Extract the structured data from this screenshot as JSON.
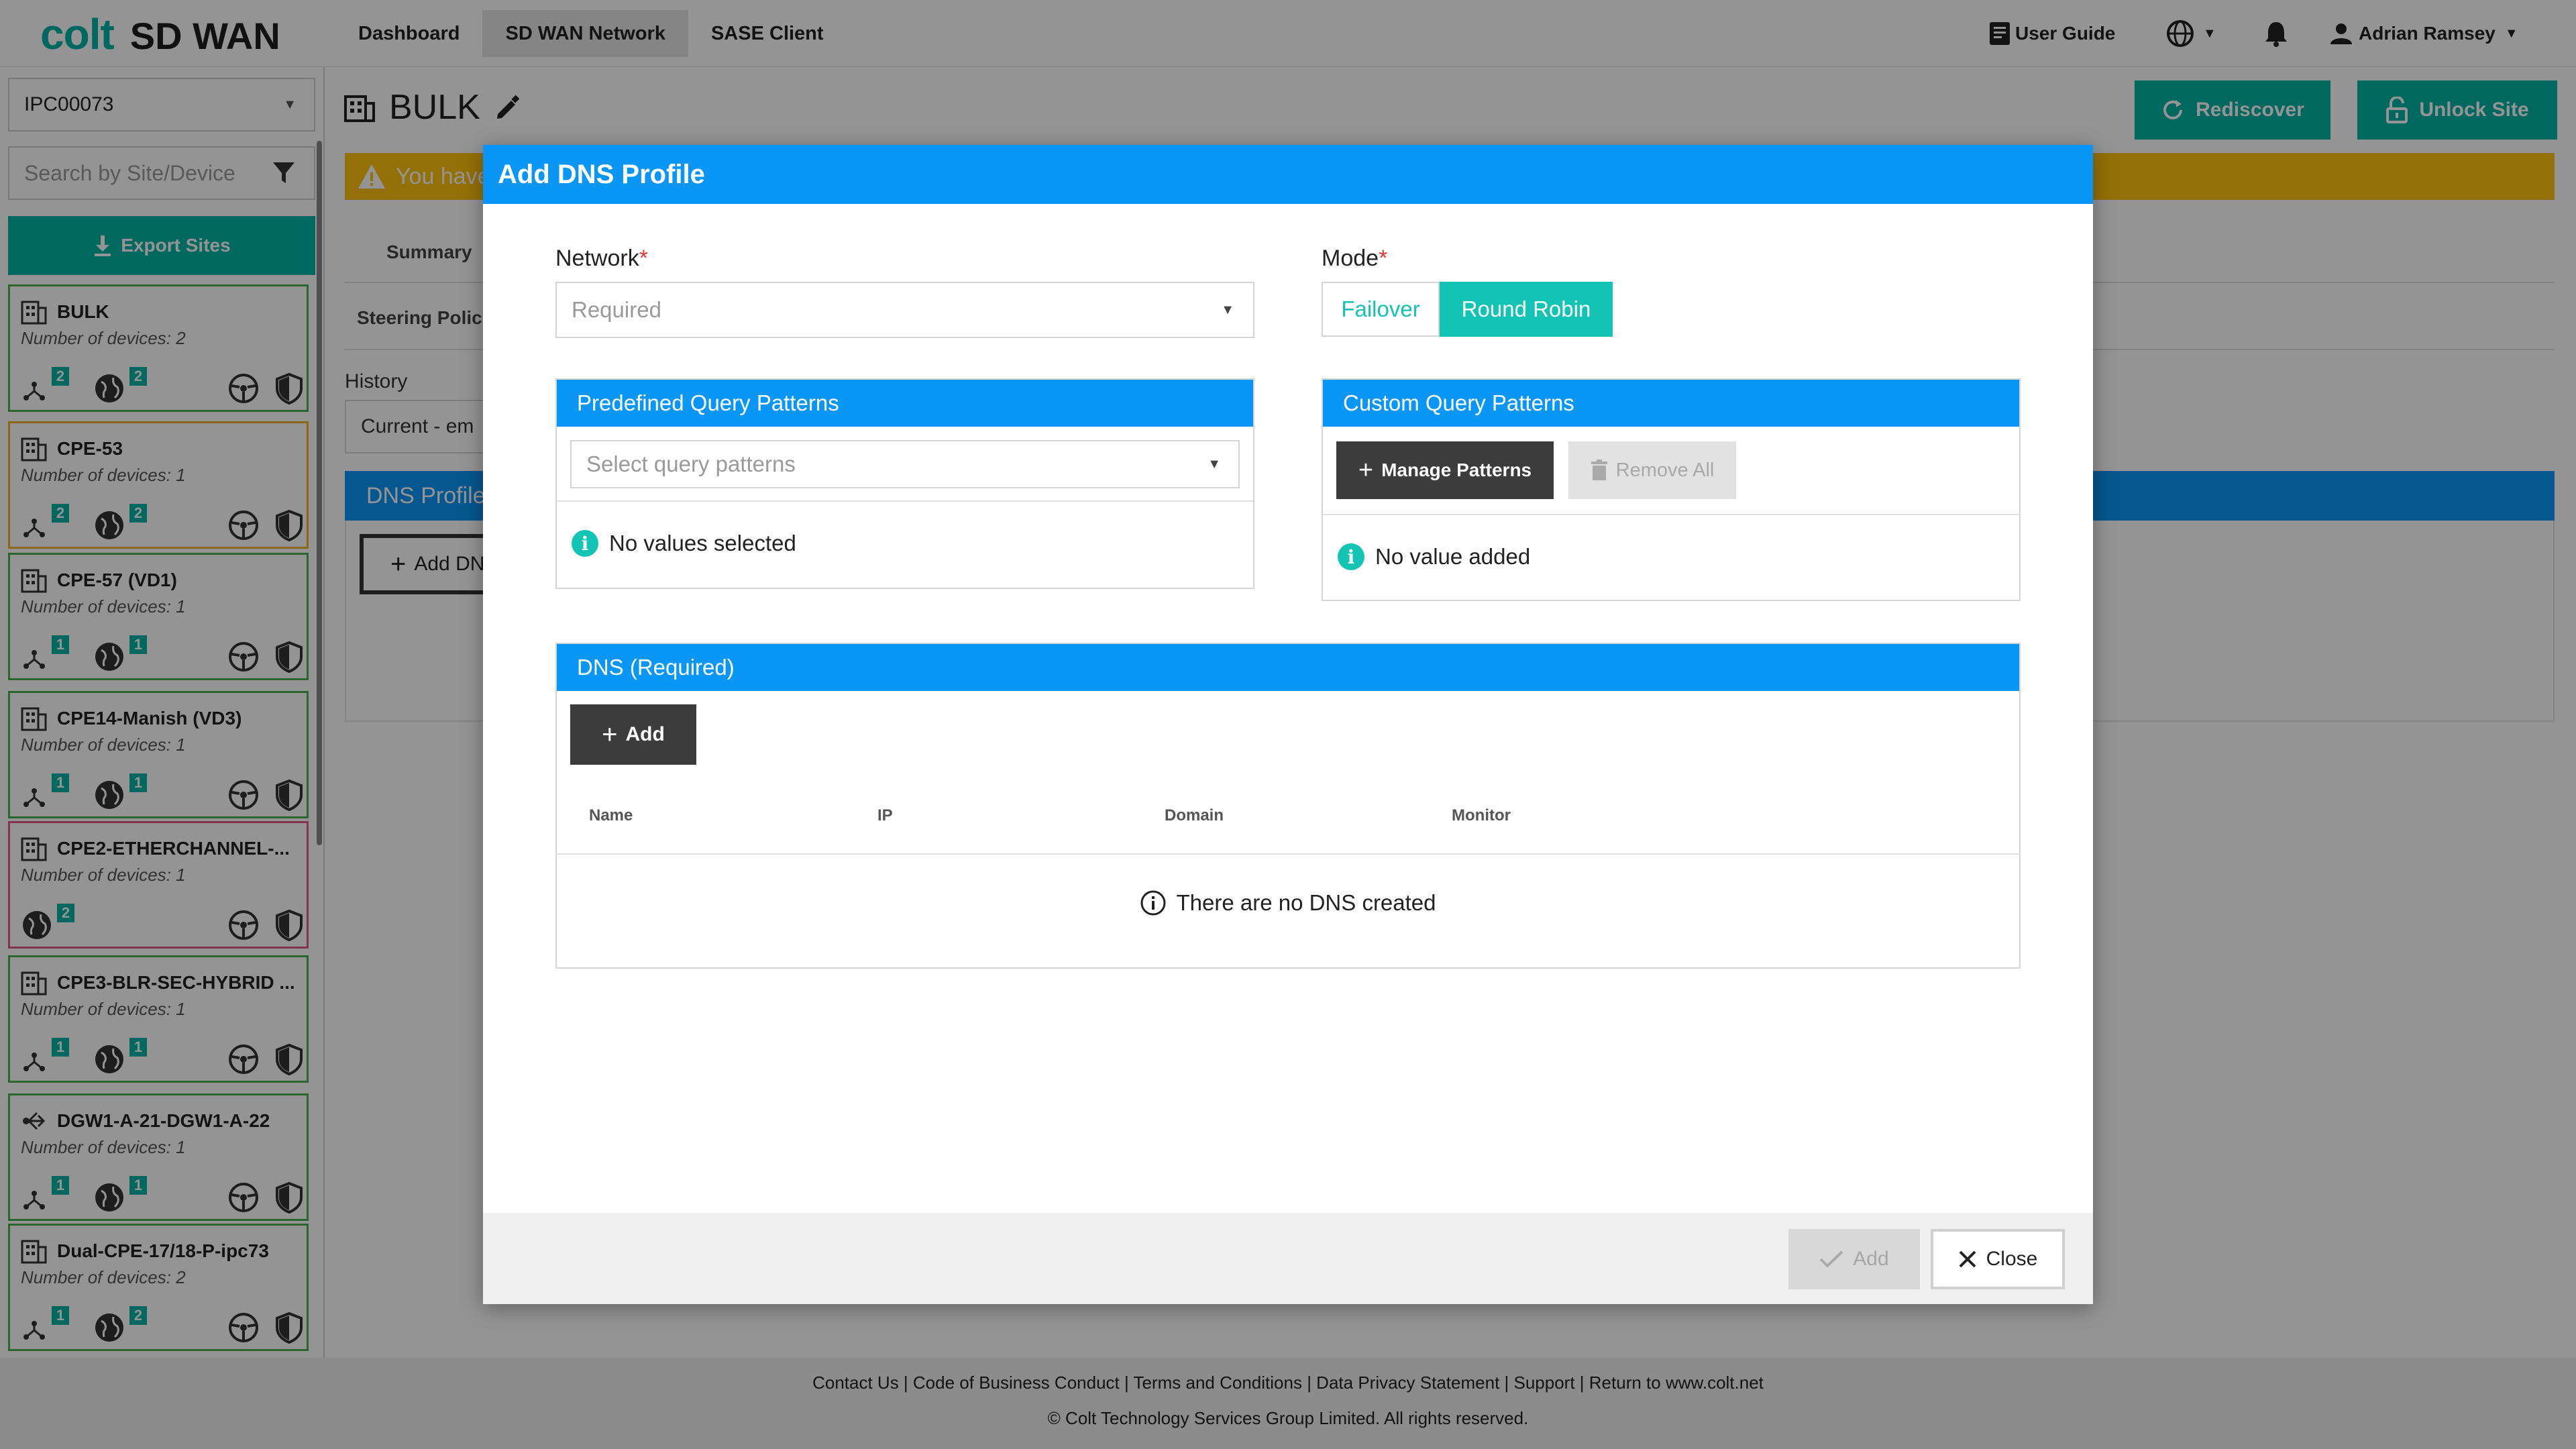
{
  "app": {
    "brand": "colt",
    "product": "SD WAN",
    "nav": [
      "Dashboard",
      "SD WAN Network",
      "SASE Client"
    ],
    "user_guide": "User Guide",
    "user_name": "Adrian Ramsey"
  },
  "sidebar": {
    "account": "IPC00073",
    "search_placeholder": "Search by Site/Device",
    "export_label": "Export Sites",
    "sites": [
      {
        "name": "BULK",
        "devices": "Number of devices: 2",
        "b1": "2",
        "b2": "2",
        "status": "#4caf50",
        "icon": "building-icon"
      },
      {
        "name": "CPE-53",
        "devices": "Number of devices: 1",
        "b1": "2",
        "b2": "2",
        "status": "#f0b323",
        "icon": "building-icon"
      },
      {
        "name": "CPE-57 (VD1)",
        "devices": "Number of devices: 1",
        "b1": "1",
        "b2": "1",
        "status": "#4caf50",
        "icon": "building-icon"
      },
      {
        "name": "CPE14-Manish (VD3)",
        "devices": "Number of devices: 1",
        "b1": "1",
        "b2": "1",
        "status": "#4caf50",
        "icon": "building-icon"
      },
      {
        "name": "CPE2-ETHERCHANNEL-...",
        "devices": "Number of devices: 1",
        "b1": "",
        "b2": "2",
        "status": "#e05a8a",
        "icon": "building-icon"
      },
      {
        "name": "CPE3-BLR-SEC-HYBRID ...",
        "devices": "Number of devices: 1",
        "b1": "1",
        "b2": "1",
        "status": "#4caf50",
        "icon": "building-icon"
      },
      {
        "name": "DGW1-A-21-DGW1-A-22",
        "devices": "Number of devices: 1",
        "b1": "1",
        "b2": "1",
        "status": "#4caf50",
        "icon": "gateway-icon"
      },
      {
        "name": "Dual-CPE-17/18-P-ipc73",
        "devices": "Number of devices: 2",
        "b1": "1",
        "b2": "2",
        "status": "#4caf50",
        "icon": "building-icon"
      }
    ]
  },
  "main": {
    "site_title": "BULK",
    "rediscover": "Rediscover",
    "unlock_site": "Unlock Site",
    "warning_text": "You have",
    "tab_summary": "Summary",
    "tab_steering": "Steering Polic",
    "history_label": "History",
    "history_value": "Current - em",
    "dns_profile_header": "DNS Profile",
    "add_dns_button": "Add DN"
  },
  "modal": {
    "title": "Add DNS Profile",
    "network_label": "Network",
    "network_placeholder": "Required",
    "mode_label": "Mode",
    "mode_options": [
      "Failover",
      "Round Robin"
    ],
    "mode_selected": "Round Robin",
    "predefined_header": "Predefined Query Patterns",
    "predefined_placeholder": "Select query patterns",
    "predefined_empty": "No values selected",
    "custom_header": "Custom Query Patterns",
    "manage_patterns": "Manage Patterns",
    "remove_all": "Remove All",
    "custom_empty": "No value added",
    "dns_header": "DNS (Required)",
    "dns_add": "Add",
    "columns": [
      "Name",
      "IP",
      "Domain",
      "Monitor"
    ],
    "dns_empty": "There are no DNS created",
    "footer_add": "Add",
    "footer_close": "Close"
  },
  "footer": {
    "links": [
      "Contact Us",
      "Code of Business Conduct",
      "Terms and Conditions",
      "Data Privacy Statement",
      "Support",
      "Return to www.colt.net"
    ],
    "copyright": "© Colt Technology Services Group Limited. All rights reserved."
  },
  "colors": {
    "brand_teal": "#00b3a4",
    "modal_blue": "#0a96f7",
    "warning_yellow": "#ffc20e",
    "dark_button": "#3c3c3c"
  }
}
